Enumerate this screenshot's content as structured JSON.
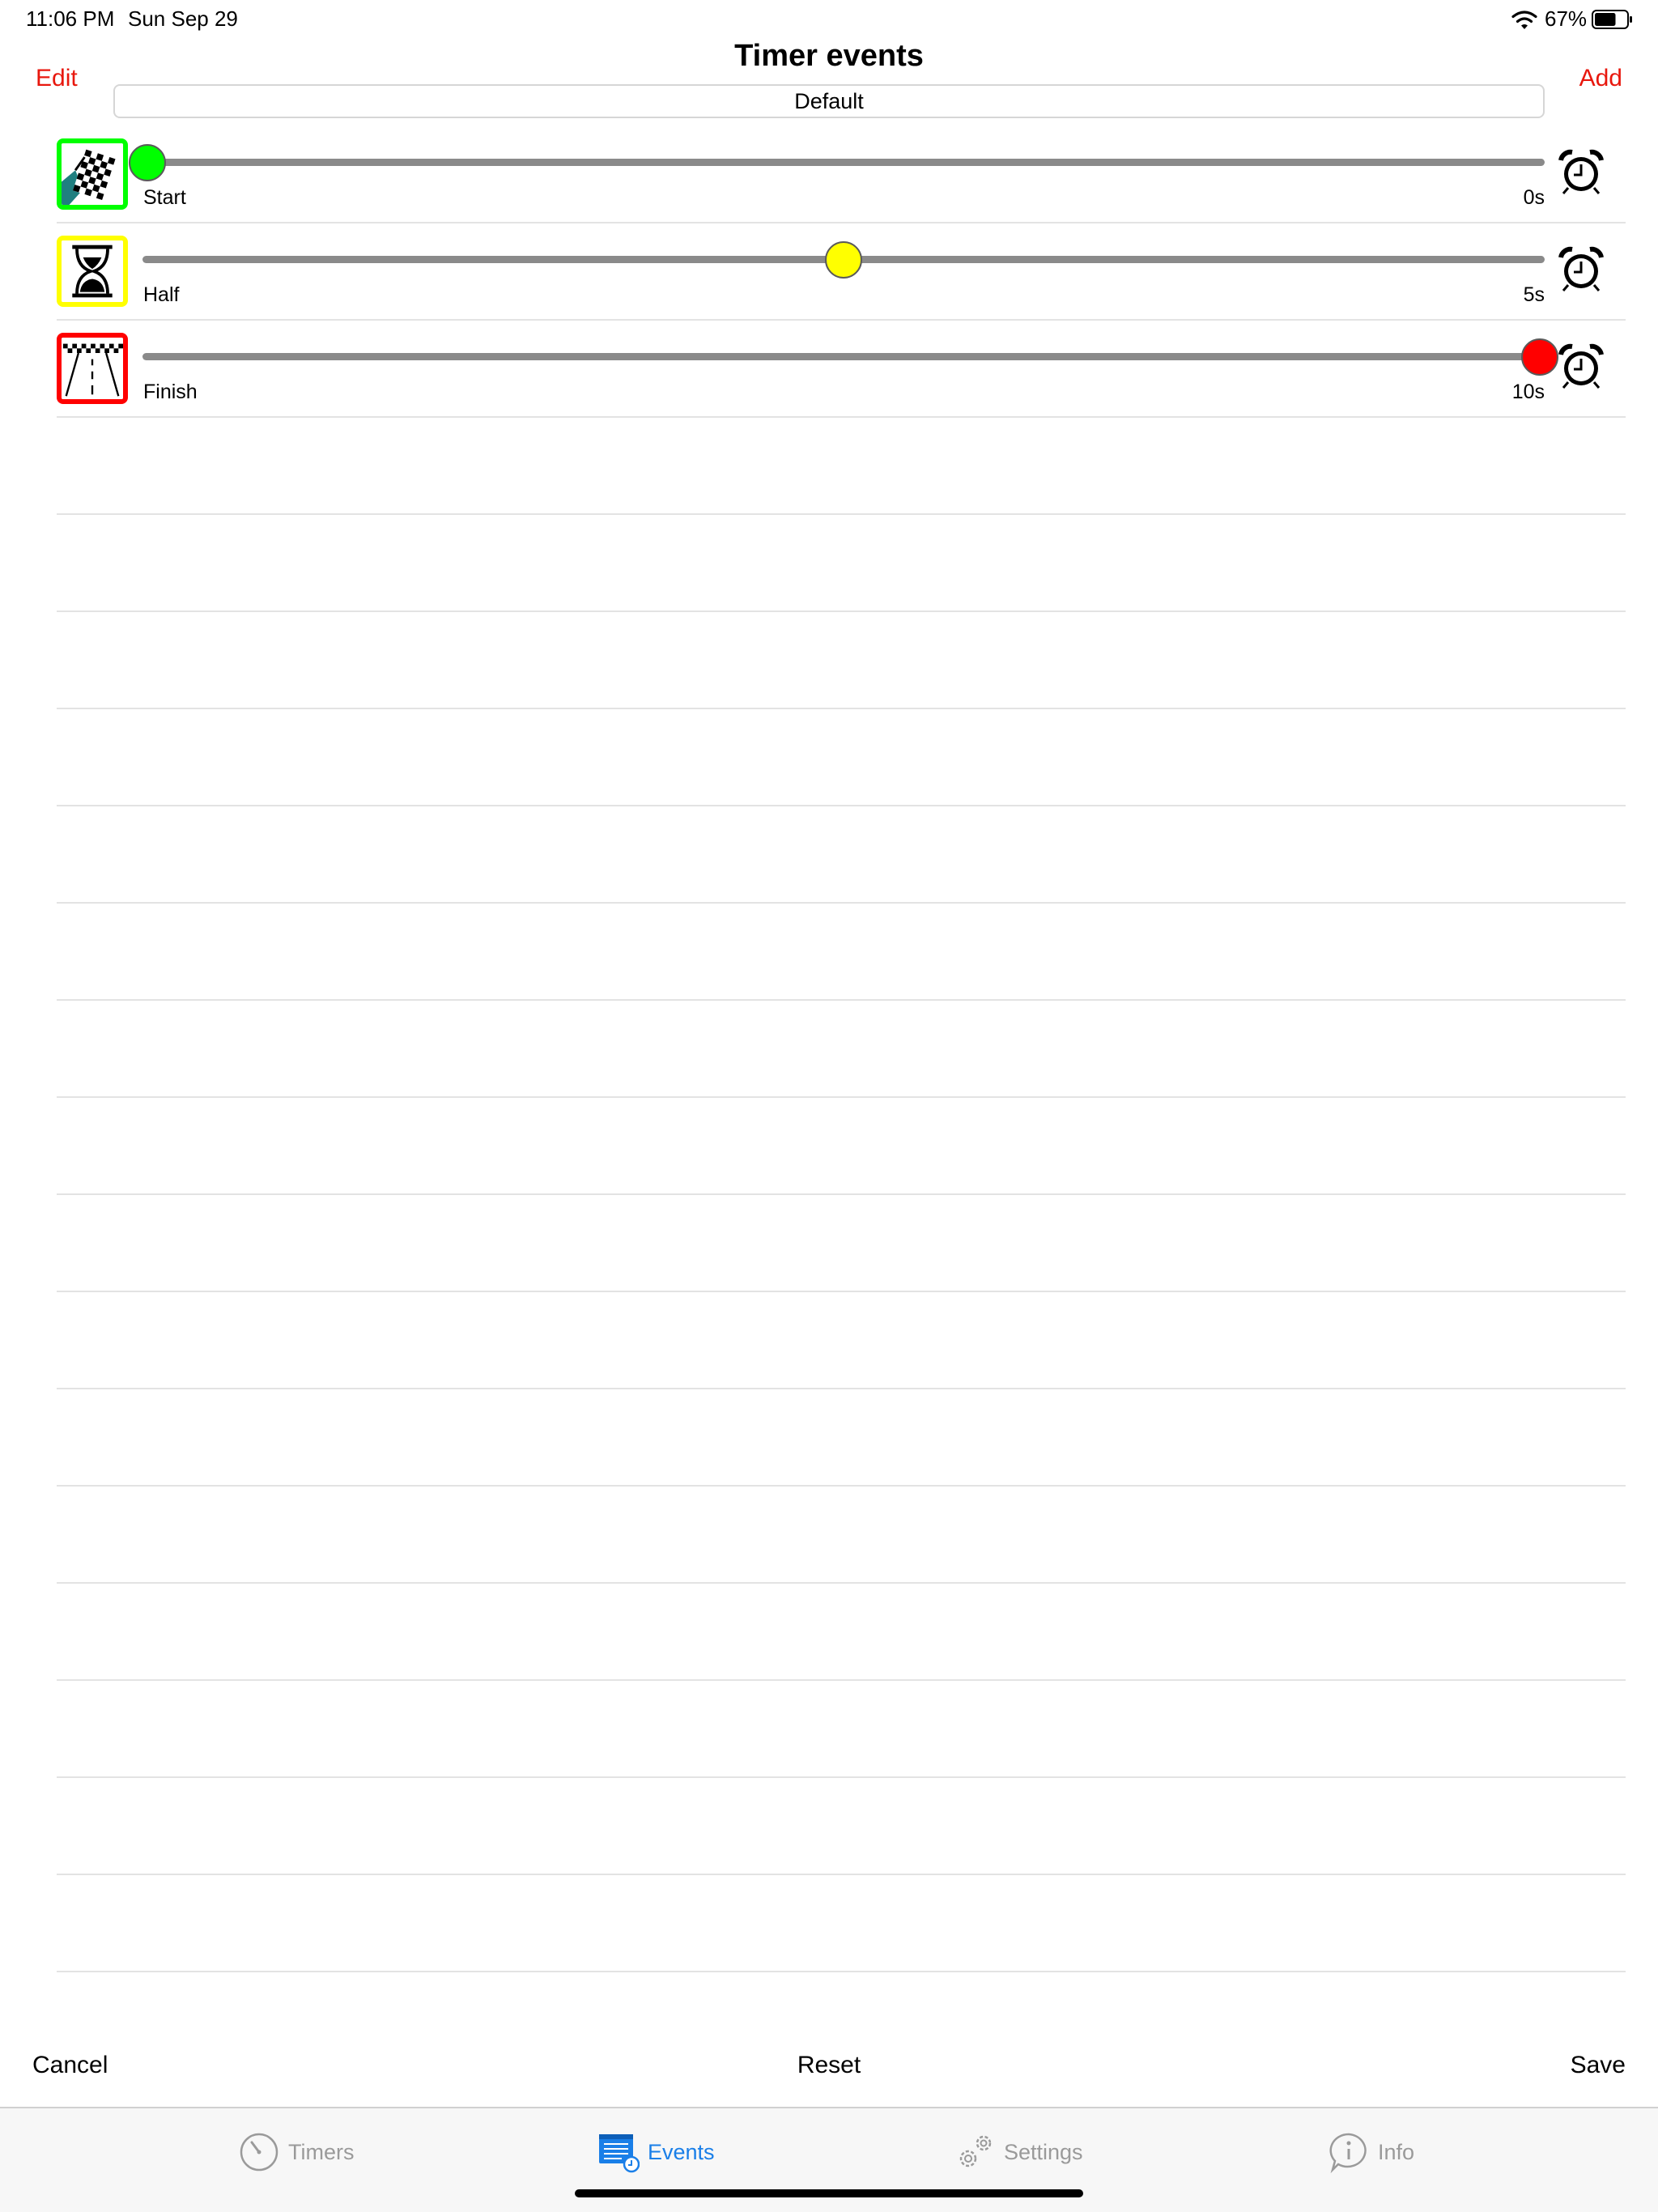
{
  "status_bar": {
    "time": "11:06 PM",
    "date": "Sun Sep 29",
    "battery_percent": "67%",
    "battery_level": 0.67
  },
  "header": {
    "edit_label": "Edit",
    "title": "Timer events",
    "add_label": "Add",
    "preset_value": "Default"
  },
  "events": [
    {
      "label": "Start",
      "value": "0s",
      "slider_fraction": 0.0,
      "thumb_color": "#00ff00",
      "icon": "checkered-flag-icon",
      "icon_border_color": "#00ff00"
    },
    {
      "label": "Half",
      "value": "5s",
      "slider_fraction": 0.5,
      "thumb_color": "#ffff00",
      "icon": "hourglass-icon",
      "icon_border_color": "#ffff00"
    },
    {
      "label": "Finish",
      "value": "10s",
      "slider_fraction": 1.0,
      "thumb_color": "#ff0000",
      "icon": "finish-line-icon",
      "icon_border_color": "#ff0000"
    }
  ],
  "empty_rows": 16,
  "toolbar": {
    "cancel_label": "Cancel",
    "reset_label": "Reset",
    "save_label": "Save"
  },
  "tabs": [
    {
      "label": "Timers",
      "icon": "timer-icon",
      "active": false
    },
    {
      "label": "Events",
      "icon": "events-icon",
      "active": true
    },
    {
      "label": "Settings",
      "icon": "settings-icon",
      "active": false
    },
    {
      "label": "Info",
      "icon": "info-icon",
      "active": false
    }
  ],
  "colors": {
    "accent": "#e8170d",
    "active_tab": "#1a7fe8",
    "inactive_tab": "#9a9a9a"
  }
}
